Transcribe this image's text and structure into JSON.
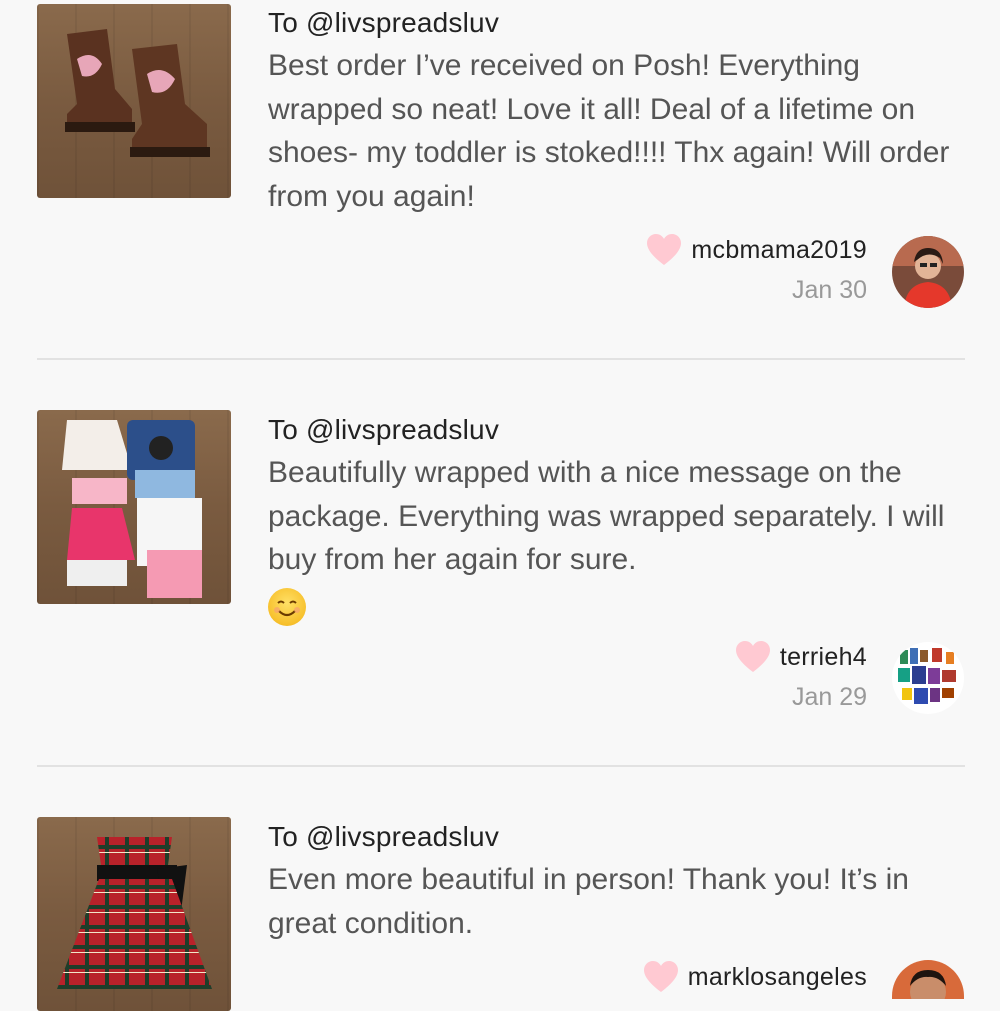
{
  "reviews": [
    {
      "to": "To @livspreadsluv",
      "text": "Best order I’ve received on Posh! Everything wrapped so neat! Love it all! Deal of a lifetime on shoes- my toddler is stoked!!!! Thx again! Will order from you again!",
      "username": "mcbmama2019",
      "date": "Jan 30",
      "image": "cowboy-boots-photo",
      "avatar": "woman-red-top-avatar"
    },
    {
      "to": "To @livspreadsluv",
      "text": "Beautifully wrapped with a nice message on the package. Everything was wrapped separately. I will buy from her again for sure.",
      "emoji": "smiling-face-emoji",
      "username": "terrieh4",
      "date": "Jan 29",
      "image": "girls-clothing-lot-photo",
      "avatar": "clothing-collage-avatar"
    },
    {
      "to": "To @livspreadsluv",
      "text": "Even more beautiful in person! Thank you! It’s in great condition.",
      "username": "marklosangeles",
      "image": "plaid-dress-photo",
      "avatar": "man-smiling-avatar"
    }
  ],
  "colors": {
    "heart": "#ffc9d2",
    "divider": "#e2e2e2",
    "date": "#999999"
  }
}
